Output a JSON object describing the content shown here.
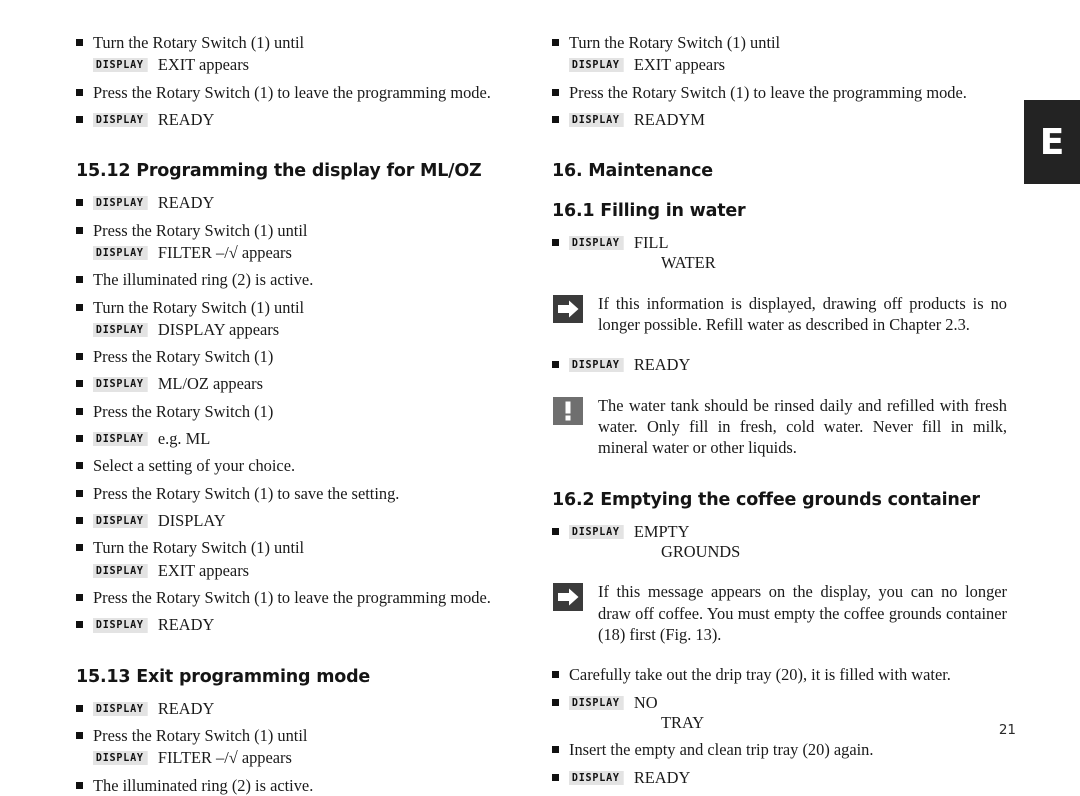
{
  "page": {
    "number": "21",
    "edge_tab": "E",
    "display_tag_label": "DISPLAY",
    "display_tag_bg": "#e3e3e3",
    "edge_tab_bg": "#232323",
    "text_color": "#1a1a1a"
  },
  "left_column": {
    "top_block": [
      {
        "kind": "instruction",
        "text": "Turn the Rotary Switch (1) until",
        "sub_display": "DISPLAY",
        "sub_value": "EXIT appears"
      },
      {
        "kind": "instruction",
        "text": "Press the Rotary Switch (1) to leave the programming mode."
      },
      {
        "kind": "display",
        "display": "DISPLAY",
        "value": "READY"
      }
    ],
    "section_15_12": {
      "heading": "15.12 Programming the display for ML/OZ",
      "items": [
        {
          "kind": "display",
          "display": "DISPLAY",
          "value": "READY"
        },
        {
          "kind": "instruction",
          "text": "Press the Rotary Switch (1) until",
          "sub_display": "DISPLAY",
          "sub_value": "FILTER –/√ appears"
        },
        {
          "kind": "instruction",
          "text": "The illuminated ring (2) is active."
        },
        {
          "kind": "instruction",
          "text": "Turn the Rotary Switch (1) until",
          "sub_display": "DISPLAY",
          "sub_value": "DISPLAY appears"
        },
        {
          "kind": "instruction",
          "text": "Press the Rotary Switch (1)"
        },
        {
          "kind": "display",
          "display": "DISPLAY",
          "value": "ML/OZ appears"
        },
        {
          "kind": "instruction",
          "text": "Press the Rotary Switch (1)"
        },
        {
          "kind": "display",
          "display": "DISPLAY",
          "value": "e.g. ML"
        },
        {
          "kind": "instruction",
          "text": "Select a setting of your choice."
        },
        {
          "kind": "instruction",
          "text": "Press the Rotary Switch (1) to save the setting."
        },
        {
          "kind": "display",
          "display": "DISPLAY",
          "value": "DISPLAY"
        },
        {
          "kind": "instruction",
          "text": "Turn the Rotary Switch (1) until",
          "sub_display": "DISPLAY",
          "sub_value": "EXIT appears"
        },
        {
          "kind": "instruction",
          "text": "Press the Rotary Switch (1) to leave the programming mode."
        },
        {
          "kind": "display",
          "display": "DISPLAY",
          "value": "READY"
        }
      ]
    },
    "section_15_13": {
      "heading": "15.13 Exit programming mode",
      "items": [
        {
          "kind": "display",
          "display": "DISPLAY",
          "value": "READY"
        },
        {
          "kind": "instruction",
          "text": "Press the Rotary Switch (1) until",
          "sub_display": "DISPLAY",
          "sub_value": "FILTER –/√ appears"
        },
        {
          "kind": "instruction",
          "text": "The illuminated ring (2) is active."
        }
      ]
    }
  },
  "right_column": {
    "top_block": [
      {
        "kind": "instruction",
        "text": "Turn the Rotary Switch (1) until",
        "sub_display": "DISPLAY",
        "sub_value": "EXIT appears"
      },
      {
        "kind": "instruction",
        "text": "Press the Rotary Switch (1) to leave the programming mode."
      },
      {
        "kind": "display",
        "display": "DISPLAY",
        "value": "READYM"
      }
    ],
    "section_16": {
      "heading": "16. Maintenance"
    },
    "section_16_1": {
      "heading": "16.1 Filling in water",
      "display_item": {
        "display": "DISPLAY",
        "value": "FILL",
        "value_line2": "WATER"
      },
      "note_arrow": "If this information is displayed, drawing off products is no longer possible. Refill water as described in Chapter 2.3.",
      "display_ready": {
        "display": "DISPLAY",
        "value": "READY"
      },
      "note_warning": "The water tank should be rinsed daily and refilled with fresh water. Only fill in fresh, cold water. Never fill in milk, mineral water or other liquids."
    },
    "section_16_2": {
      "heading": "16.2 Emptying the coffee grounds container",
      "display_item": {
        "display": "DISPLAY",
        "value": "EMPTY",
        "value_line2": "GROUNDS"
      },
      "note_arrow": "If this message appears on the display, you can no longer draw off coffee. You must empty the coffee grounds container (18) first (Fig. 13).",
      "items": [
        {
          "kind": "instruction",
          "text": "Carefully take out the drip tray (20), it is filled with water."
        },
        {
          "kind": "display",
          "display": "DISPLAY",
          "value": "NO",
          "value_line2": "TRAY"
        },
        {
          "kind": "instruction",
          "text": "Insert the empty and clean trip tray (20) again."
        },
        {
          "kind": "display",
          "display": "DISPLAY",
          "value": "READY"
        }
      ]
    }
  },
  "icons": {
    "arrow": "arrow-right-icon",
    "warning": "exclamation-icon"
  }
}
